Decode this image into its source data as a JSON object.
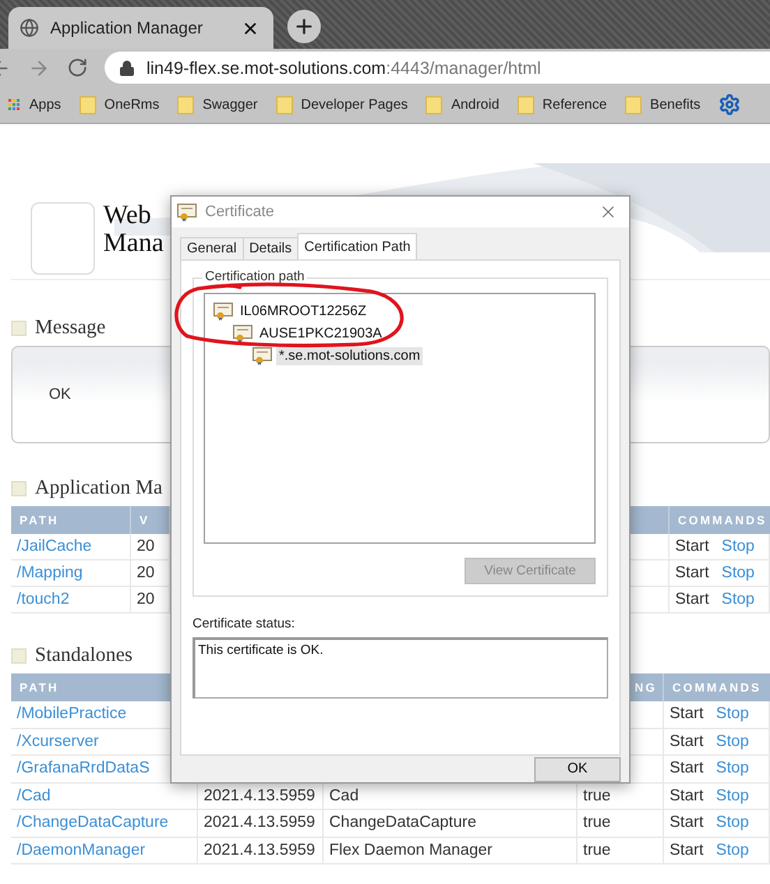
{
  "browser": {
    "tab": {
      "title": "Application Manager"
    },
    "url": {
      "host": "lin49-flex.se.mot-solutions.com",
      "path": ":4443/manager/html"
    },
    "bookmarks": [
      {
        "kind": "apps",
        "label": "Apps"
      },
      {
        "kind": "folder",
        "label": "OneRms"
      },
      {
        "kind": "folder",
        "label": "Swagger"
      },
      {
        "kind": "folder",
        "label": "Developer Pages"
      },
      {
        "kind": "folder",
        "label": "Android"
      },
      {
        "kind": "folder",
        "label": "Reference"
      },
      {
        "kind": "folder",
        "label": "Benefits"
      },
      {
        "kind": "gear"
      }
    ]
  },
  "page": {
    "title_lines": [
      "Web",
      "Mana"
    ],
    "message": {
      "heading": "Message",
      "text": "OK"
    },
    "applications": {
      "heading": "Application Ma",
      "columns": [
        "PATH",
        "V",
        "COMMANDS"
      ],
      "rows": [
        {
          "path": "/JailCache",
          "version": "20",
          "commands": [
            {
              "label": "Start",
              "link": false
            },
            {
              "label": "Stop",
              "link": true
            }
          ]
        },
        {
          "path": "/Mapping",
          "version": "20",
          "commands": [
            {
              "label": "Start",
              "link": false
            },
            {
              "label": "Stop",
              "link": true
            }
          ]
        },
        {
          "path": "/touch2",
          "version": "20",
          "commands": [
            {
              "label": "Start",
              "link": false
            },
            {
              "label": "Stop",
              "link": true
            }
          ]
        }
      ]
    },
    "standalones": {
      "heading": "Standalones",
      "columns": [
        "PATH",
        "NG",
        "COMMANDS"
      ],
      "rows": [
        {
          "path": "/MobilePractice",
          "commands": [
            {
              "label": "Start",
              "link": false
            },
            {
              "label": "Stop",
              "link": true
            }
          ]
        },
        {
          "path": "/Xcurserver",
          "commands": [
            {
              "label": "Start",
              "link": false
            },
            {
              "label": "Stop",
              "link": true
            }
          ]
        },
        {
          "path": "/GrafanaRrdDataS",
          "commands": [
            {
              "label": "Start",
              "link": false
            },
            {
              "label": "Stop",
              "link": true
            }
          ]
        },
        {
          "path": "/Cad",
          "version": "2021.4.13.5959",
          "name": "Cad",
          "running": "true",
          "commands": [
            {
              "label": "Start",
              "link": false
            },
            {
              "label": "Stop",
              "link": true
            }
          ]
        },
        {
          "path": "/ChangeDataCapture",
          "version": "2021.4.13.5959",
          "name": "ChangeDataCapture",
          "running": "true",
          "commands": [
            {
              "label": "Start",
              "link": false
            },
            {
              "label": "Stop",
              "link": true
            }
          ]
        },
        {
          "path": "/DaemonManager",
          "version": "2021.4.13.5959",
          "name": "Flex Daemon Manager",
          "running": "true",
          "commands": [
            {
              "label": "Start",
              "link": false
            },
            {
              "label": "Stop",
              "link": true
            }
          ]
        }
      ]
    }
  },
  "dialog": {
    "title": "Certificate",
    "tabs": [
      {
        "label": "General",
        "selected": false
      },
      {
        "label": "Details",
        "selected": false
      },
      {
        "label": "Certification Path",
        "selected": true
      }
    ],
    "group_label": "Certification path",
    "tree": [
      {
        "label": "IL06MROOT12256Z",
        "selected": false,
        "children": [
          {
            "label": "AUSE1PKC21903A",
            "selected": false,
            "children": [
              {
                "label": "*.se.mot-solutions.com",
                "selected": true
              }
            ]
          }
        ]
      }
    ],
    "view_button": {
      "label": "View Certificate",
      "disabled": true
    },
    "status_label": "Certificate status:",
    "status_text": "This certificate is OK.",
    "ok_button": {
      "label": "OK"
    },
    "annotation": {
      "kind": "circle"
    }
  }
}
